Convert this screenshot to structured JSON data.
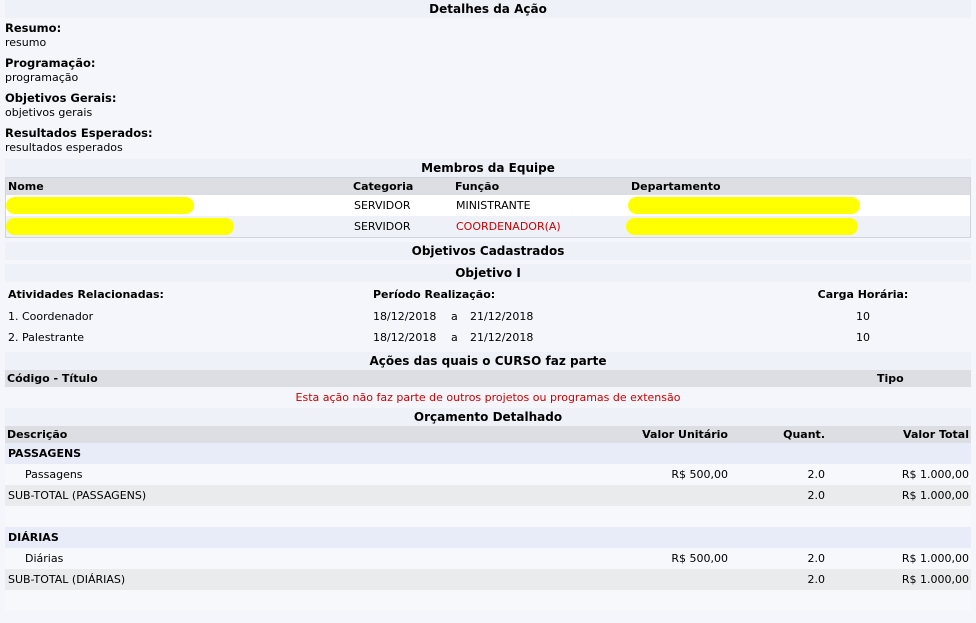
{
  "sections": {
    "detalhes": "Detalhes da Ação",
    "membros": "Membros da Equipe",
    "objetivos": "Objetivos Cadastrados",
    "objetivo_i": "Objetivo I",
    "acoes": "Ações das quais o CURSO faz parte",
    "orcamento": "Orçamento Detalhado"
  },
  "details": [
    {
      "label": "Resumo:",
      "value": "resumo"
    },
    {
      "label": "Programação:",
      "value": "programação"
    },
    {
      "label": "Objetivos Gerais:",
      "value": "objetivos gerais"
    },
    {
      "label": "Resultados Esperados:",
      "value": "resultados esperados"
    }
  ],
  "team": {
    "headers": {
      "nome": "Nome",
      "categoria": "Categoria",
      "funcao": "Função",
      "departamento": "Departamento"
    },
    "rows": [
      {
        "nome": "",
        "categoria": "SERVIDOR",
        "funcao": "MINISTRANTE"
      },
      {
        "nome": "",
        "categoria": "SERVIDOR",
        "funcao": "COORDENADOR(A)"
      }
    ],
    "highlight_color": "#ffff00"
  },
  "objetivos": {
    "headers": {
      "atividades": "Atividades Relacionadas:",
      "periodo": "Período Realização:",
      "carga": "Carga Horária:"
    },
    "rows": [
      {
        "atividade": "1. Coordenador",
        "inicio": "18/12/2018",
        "sep": "a",
        "fim": "21/12/2018",
        "carga": "10"
      },
      {
        "atividade": "2. Palestrante",
        "inicio": "18/12/2018",
        "sep": "a",
        "fim": "21/12/2018",
        "carga": "10"
      }
    ]
  },
  "acoes": {
    "headers": {
      "codigo": "Código - Título",
      "tipo": "Tipo"
    },
    "empty_message": "Esta ação não faz parte de outros projetos ou programas de extensão"
  },
  "orcamento": {
    "headers": {
      "descricao": "Descrição",
      "valor_unitario": "Valor Unitário",
      "quant": "Quant.",
      "valor_total": "Valor Total"
    },
    "groups": [
      {
        "name": "PASSAGENS",
        "item": {
          "descricao": "Passagens",
          "valor_unitario": "R$ 500,00",
          "quant": "2.0",
          "valor_total": "R$ 1.000,00"
        },
        "subtotal": {
          "descricao": "SUB-TOTAL (PASSAGENS)",
          "quant": "2.0",
          "valor_total": "R$ 1.000,00"
        }
      },
      {
        "name": "DIÁRIAS",
        "item": {
          "descricao": "Diárias",
          "valor_unitario": "R$ 500,00",
          "quant": "2.0",
          "valor_total": "R$ 1.000,00"
        },
        "subtotal": {
          "descricao": "SUB-TOTAL (DIÁRIAS)",
          "quant": "2.0",
          "valor_total": "R$ 1.000,00"
        }
      }
    ]
  },
  "colors": {
    "accent_red": "#cc0000",
    "header_gray": "#dcdee3",
    "row_blue": "#e8ecf8"
  }
}
